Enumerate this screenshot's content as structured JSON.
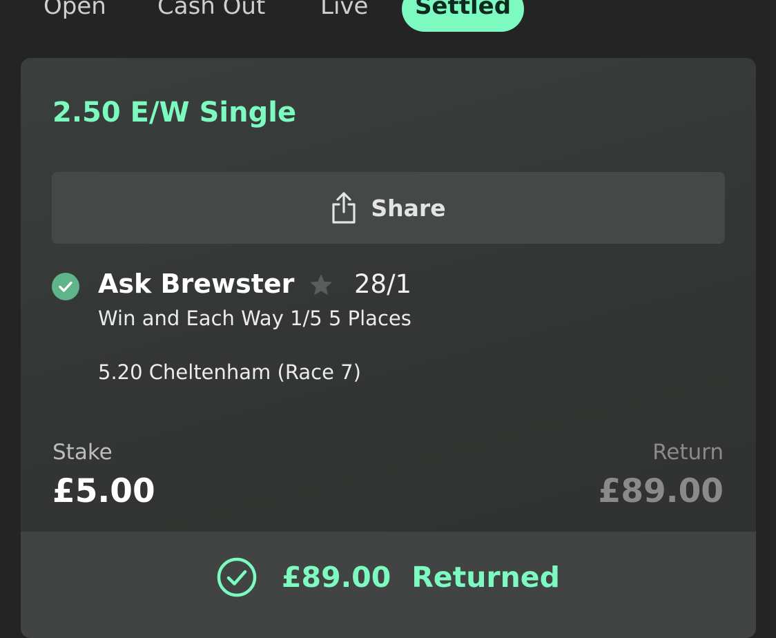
{
  "tabs": [
    {
      "label": "Open"
    },
    {
      "label": "Cash Out"
    },
    {
      "label": "Live"
    },
    {
      "label": "Settled",
      "active": true
    }
  ],
  "bet": {
    "title": "2.50 E/W Single",
    "share_label": "Share",
    "selection": {
      "name": "Ask Brewster",
      "odds": "28/1",
      "market": "Win and Each Way 1/5 5 Places",
      "event": "5.20 Cheltenham (Race 7)",
      "status_icon": "check-circle-icon",
      "favourite_icon": "star-icon"
    },
    "stake_label": "Stake",
    "stake_value": "£5.00",
    "return_label": "Return",
    "return_value": "£89.00",
    "returned_amount": "£89.00",
    "returned_text": "Returned"
  },
  "colors": {
    "accent": "#7cfac0",
    "background": "#242424",
    "card": "#373a39",
    "share_button": "#444847",
    "check_badge": "#5fb48a",
    "muted": "#8a8a8a"
  }
}
